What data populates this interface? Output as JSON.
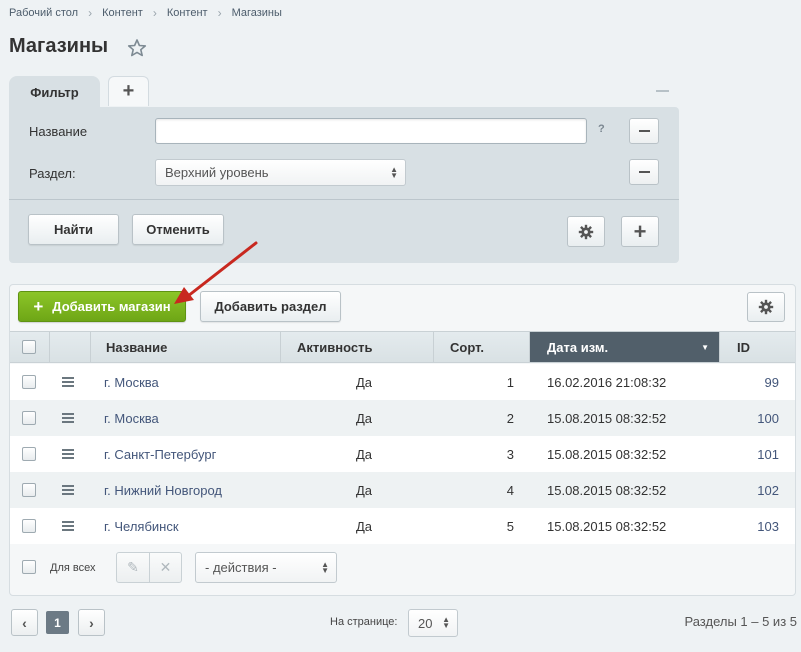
{
  "breadcrumb": [
    "Рабочий стол",
    "Контент",
    "Контент",
    "Магазины"
  ],
  "page": {
    "title": "Магазины"
  },
  "filter": {
    "tab_label": "Фильтр",
    "fields": {
      "name_label": "Название",
      "name_value": "",
      "help": "?",
      "section_label": "Раздел:",
      "section_value": "Верхний уровень"
    },
    "find_button": "Найти",
    "cancel_button": "Отменить"
  },
  "toolbar": {
    "add_store_button": "Добавить магазин",
    "add_section_button": "Добавить раздел"
  },
  "table": {
    "columns": {
      "name": "Название",
      "active": "Активность",
      "sort": "Сорт.",
      "date": "Дата изм.",
      "id": "ID"
    },
    "rows": [
      {
        "name": "г. Москва",
        "active": "Да",
        "sort": "1",
        "date": "16.02.2016 21:08:32",
        "id": "99"
      },
      {
        "name": "г. Москва",
        "active": "Да",
        "sort": "2",
        "date": "15.08.2015 08:32:52",
        "id": "100"
      },
      {
        "name": "г. Санкт-Петербург",
        "active": "Да",
        "sort": "3",
        "date": "15.08.2015 08:32:52",
        "id": "101"
      },
      {
        "name": "г. Нижний Новгород",
        "active": "Да",
        "sort": "4",
        "date": "15.08.2015 08:32:52",
        "id": "102"
      },
      {
        "name": "г. Челябинск",
        "active": "Да",
        "sort": "5",
        "date": "15.08.2015 08:32:52",
        "id": "103"
      }
    ]
  },
  "footer": {
    "for_all_label": "Для всех",
    "actions_select": "- действия -"
  },
  "pagination": {
    "current_page": "1",
    "per_page_label": "На странице:",
    "per_page_value": "20",
    "total": "Разделы 1 – 5 из 5"
  },
  "colors": {
    "accent_green": "#7ab51d",
    "sorted_header": "#515f6a",
    "annotation_arrow": "#c8281f"
  }
}
